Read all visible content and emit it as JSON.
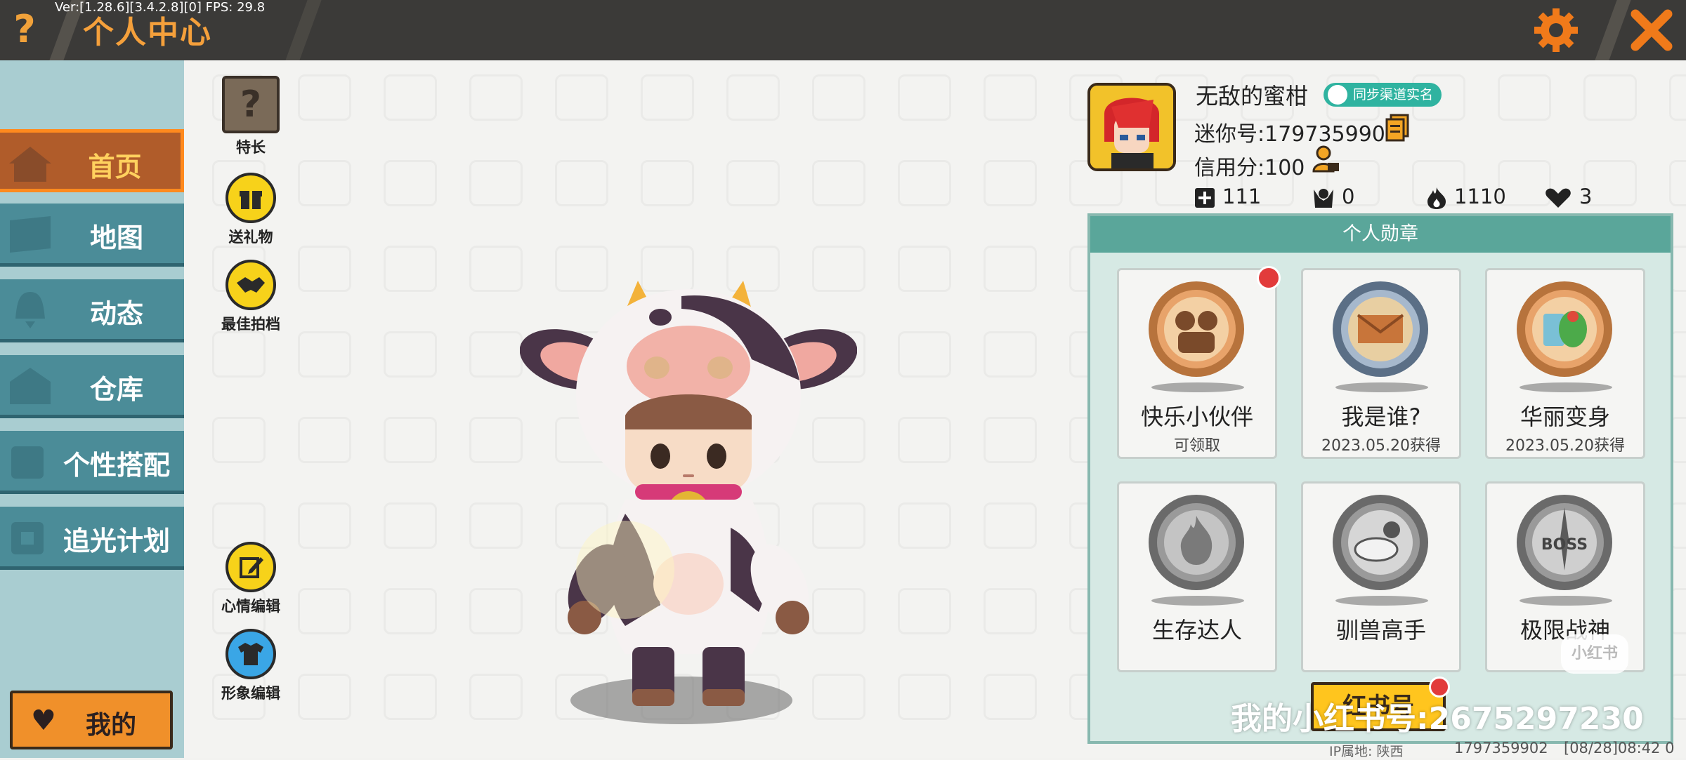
{
  "topbar": {
    "version": "Ver:[1.28.6][3.4.2.8][0] FPS: 29.8",
    "title": "个人中心",
    "help_glyph": "?",
    "accent": "#f5a03b"
  },
  "sidebar": {
    "items": [
      {
        "label": "首页",
        "icon": "house-icon",
        "active": true
      },
      {
        "label": "地图",
        "icon": "map-icon",
        "active": false
      },
      {
        "label": "动态",
        "icon": "bell-icon",
        "active": false
      },
      {
        "label": "仓库",
        "icon": "warehouse-icon",
        "active": false
      },
      {
        "label": "个性搭配",
        "icon": "outfit-icon",
        "active": false
      },
      {
        "label": "追光计划",
        "icon": "spotlight-icon",
        "active": false
      }
    ],
    "my_label": "我的"
  },
  "actions": {
    "specialty": "特长",
    "gift": "送礼物",
    "best_photo": "最佳拍档",
    "mood_edit": "心情编辑",
    "look_edit": "形象编辑"
  },
  "profile": {
    "username": "无敌的蜜柑",
    "verify_badge": "同步渠道实名",
    "mini_id": "迷你号:1797359902",
    "credit": "信用分:100",
    "stats": {
      "follow": "111",
      "fans": "0",
      "popularity": "1110",
      "likes": "3"
    }
  },
  "medals": {
    "title": "个人勋章",
    "cards": [
      {
        "name": "快乐小伙伴",
        "sub": "可领取",
        "style": "bronze",
        "has_dot": true
      },
      {
        "name": "我是谁?",
        "sub": "2023.05.20获得",
        "style": "steel",
        "has_dot": false
      },
      {
        "name": "华丽变身",
        "sub": "2023.05.20获得",
        "style": "bronze",
        "has_dot": false
      },
      {
        "name": "生存达人",
        "sub": "",
        "style": "gray",
        "has_dot": false
      },
      {
        "name": "驯兽高手",
        "sub": "",
        "style": "gray",
        "has_dot": false
      },
      {
        "name": "极限战神",
        "sub": "",
        "style": "gray",
        "has_dot": false
      }
    ],
    "claim_label": "红书号"
  },
  "footer": {
    "watermark": "我的小红书号:2675297230",
    "xhs_logo": "小红书",
    "ip": "IP属地: 陕西",
    "id": "1797359902",
    "time": "[08/28]08:42 0"
  }
}
